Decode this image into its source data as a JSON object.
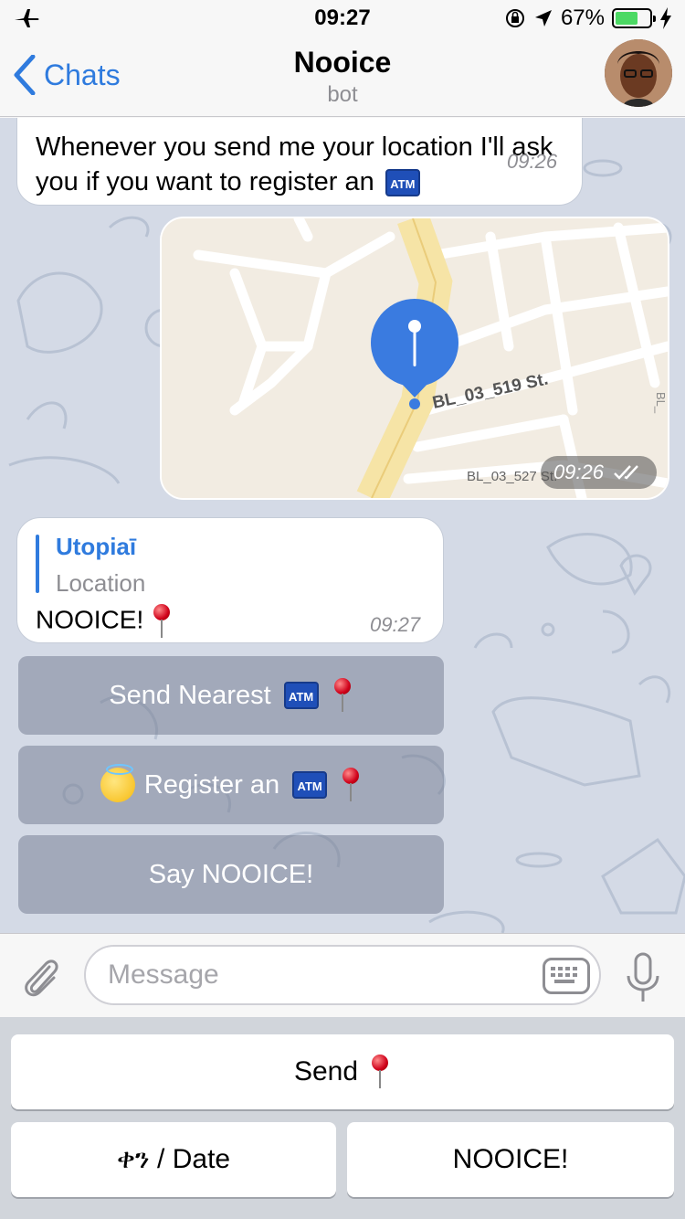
{
  "status_bar": {
    "time": "09:27",
    "battery": "67%",
    "battery_level": 0.67
  },
  "nav": {
    "back_label": "Chats",
    "title": "Nooice",
    "subtitle": "bot"
  },
  "messages": {
    "intro": {
      "text": "Whenever you send me your location I'll ask you if you want to register an",
      "atm": "ATM",
      "time": "09:26"
    },
    "map": {
      "street_1": "BL_03_519 St.",
      "street_2": "BL_03_527 St.",
      "street_3": "BL_",
      "time": "09:26"
    },
    "reply": {
      "name": "Utopiaī",
      "type": "Location",
      "text": "NOOICE!",
      "time": "09:27"
    }
  },
  "inline_keyboard": [
    {
      "label": "Send Nearest",
      "atm": "ATM"
    },
    {
      "label": "Register an",
      "atm": "ATM"
    },
    {
      "label": "Say NOOICE!"
    }
  ],
  "input": {
    "placeholder": "Message"
  },
  "reply_keyboard": {
    "send": "Send",
    "date": "ቀን / Date",
    "nooice": "NOOICE!"
  },
  "colors": {
    "accent": "#2f7bde",
    "battery": "#4cd964",
    "chat_bg": "#d4dae6"
  }
}
